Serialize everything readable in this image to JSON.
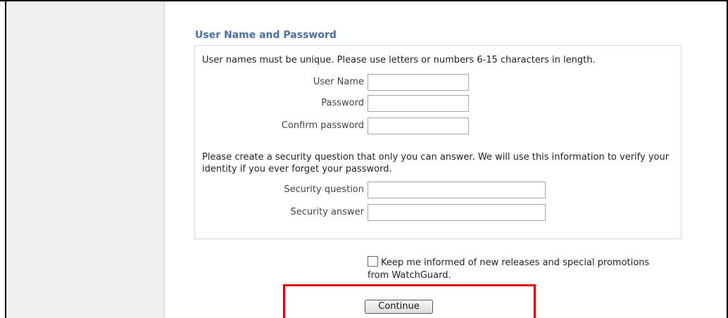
{
  "section": {
    "title": "User Name and Password"
  },
  "credentials": {
    "intro": "User names must be unique. Please use letters or numbers 6-15 characters in length.",
    "username_label": "User Name",
    "username_value": "",
    "password_label": "Password",
    "password_value": "",
    "confirm_label": "Confirm password",
    "confirm_value": ""
  },
  "security": {
    "paragraph": "Please create a security question that only you can answer. We will use this information to verify your identity if you ever forget your password.",
    "question_label": "Security question",
    "question_value": "",
    "answer_label": "Security answer",
    "answer_value": ""
  },
  "optin": {
    "label": "Keep me informed of new releases and special promotions from WatchGuard.",
    "checked": false
  },
  "actions": {
    "continue_label": "Continue"
  },
  "colors": {
    "title": "#4a6fa5",
    "highlight": "#e00000"
  }
}
